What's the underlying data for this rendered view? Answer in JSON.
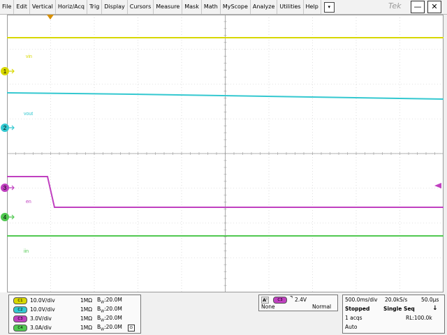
{
  "menu": {
    "items": [
      "File",
      "Edit",
      "Vertical",
      "Horiz/Acq",
      "Trig",
      "Display",
      "Cursors",
      "Measure",
      "Mask",
      "Math",
      "MyScope",
      "Analyze",
      "Utilities",
      "Help"
    ],
    "dropdown_glyph": "▾",
    "brand": "Tek",
    "minimize_glyph": "—",
    "close_glyph": "✕"
  },
  "trace_labels": {
    "ch1": "vin",
    "ch2": "vout",
    "ch3": "en",
    "ch4": "iin"
  },
  "channel_markers": {
    "ch1": "1",
    "ch2": "2",
    "ch3": "3",
    "ch4": "4"
  },
  "channels": [
    {
      "badge": "C1",
      "scale": "10.0V/div",
      "impedance": "1MΩ",
      "bw": "B",
      "bw_sub": "W",
      "bw_val": ":20.0M",
      "color": "#d8d800"
    },
    {
      "badge": "C2",
      "scale": "10.0V/div",
      "impedance": "1MΩ",
      "bw": "B",
      "bw_sub": "W",
      "bw_val": ":20.0M",
      "color": "#33c8d0"
    },
    {
      "badge": "C3",
      "scale": "3.0V/div",
      "impedance": "1MΩ",
      "bw": "B",
      "bw_sub": "W",
      "bw_val": ":20.0M",
      "color": "#c040c0"
    },
    {
      "badge": "C4",
      "scale": "3.0A/div",
      "impedance": "1MΩ",
      "bw": "B",
      "bw_sub": "W",
      "bw_val": ":20.0M",
      "color": "#50c850"
    }
  ],
  "trigger": {
    "mode": "A'",
    "source": "C3",
    "level": "2.4V",
    "coupling": "None",
    "type": "Normal"
  },
  "acquisition": {
    "timebase": "500.0ms/div",
    "sample_rate": "20.0kS/s",
    "resolution": "50.0μs",
    "state": "Stopped",
    "seq": "Single Seq",
    "acqs": "1 acqs",
    "record_length": "RL:100.0k",
    "run_mode": "Auto"
  },
  "colors": {
    "ch1": "#d8d800",
    "ch2": "#33c8d0",
    "ch3": "#c040c0",
    "ch4": "#50c850",
    "trigger": "#d89000"
  }
}
